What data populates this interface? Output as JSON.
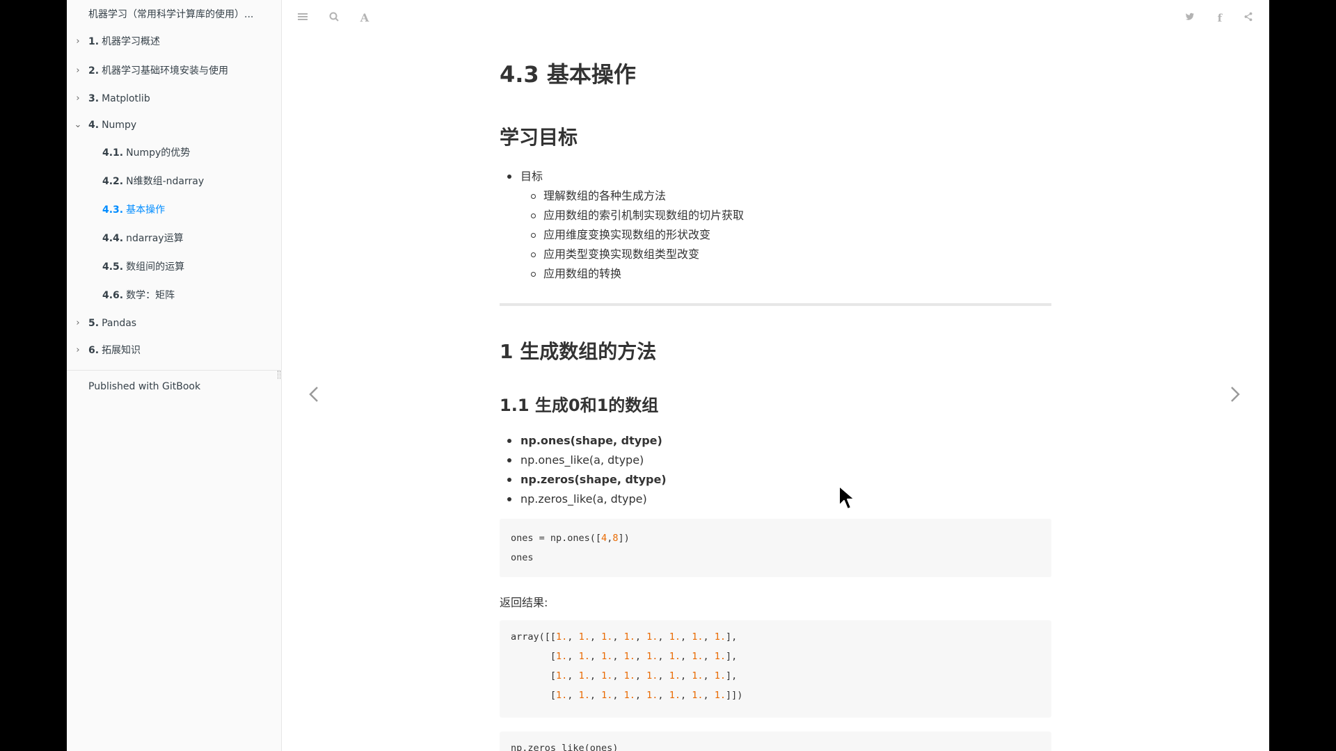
{
  "sidebar": {
    "book_title": "机器学习（常用科学计算库的使用）...",
    "items": [
      {
        "num": "1.",
        "label": "机器学习概述",
        "chevron": "›"
      },
      {
        "num": "2.",
        "label": "机器学习基础环境安装与使用",
        "chevron": "›"
      },
      {
        "num": "3.",
        "label": "Matplotlib",
        "chevron": "›"
      },
      {
        "num": "4.",
        "label": "Numpy",
        "chevron": "⌄"
      },
      {
        "num": "4.1.",
        "label": "Numpy的优势"
      },
      {
        "num": "4.2.",
        "label": "N维数组-ndarray"
      },
      {
        "num": "4.3.",
        "label": "基本操作"
      },
      {
        "num": "4.4.",
        "label": "ndarray运算"
      },
      {
        "num": "4.5.",
        "label": "数组间的运算"
      },
      {
        "num": "4.6.",
        "label": "数学：矩阵"
      },
      {
        "num": "5.",
        "label": "Pandas",
        "chevron": "›"
      },
      {
        "num": "6.",
        "label": "拓展知识",
        "chevron": "›"
      }
    ],
    "published": "Published with GitBook",
    "active_color": "#008cff"
  },
  "header": {
    "icons": [
      "menu-icon",
      "search-icon",
      "font-settings-icon",
      "twitter-icon",
      "facebook-icon",
      "share-icon"
    ],
    "font_icon_glyph": "A",
    "facebook_glyph": "f"
  },
  "content": {
    "title": "4.3 基本操作",
    "section_goals": "学习目标",
    "goals_label": "目标",
    "goals": [
      "理解数组的各种生成方法",
      "应用数组的索引机制实现数组的切片获取",
      "应用维度变换实现数组的形状改变",
      "应用类型变换实现数组类型改变",
      "应用数组的转换"
    ],
    "section1": "1 生成数组的方法",
    "section1_1": "1.1 生成0和1的数组",
    "funcs": [
      {
        "text": "np.ones(shape, dtype)",
        "bold": true
      },
      {
        "text": "np.ones_like(a, dtype)",
        "bold": false
      },
      {
        "text": "np.zeros(shape, dtype)",
        "bold": true
      },
      {
        "text": "np.zeros_like(a, dtype)",
        "bold": false
      }
    ],
    "code1": {
      "line1_a": "ones = np.ones([",
      "line1_n1": "4",
      "line1_sep": ",",
      "line1_n2": "8",
      "line1_b": "])",
      "line2": "ones"
    },
    "result_label": "返回结果:",
    "result_prefix_first": "array([[",
    "result_prefix_rest": "       [",
    "result_value": "1.",
    "result_row_end": "],",
    "result_last_end": "]])",
    "code2_partial": "np.zeros_like(ones)"
  }
}
